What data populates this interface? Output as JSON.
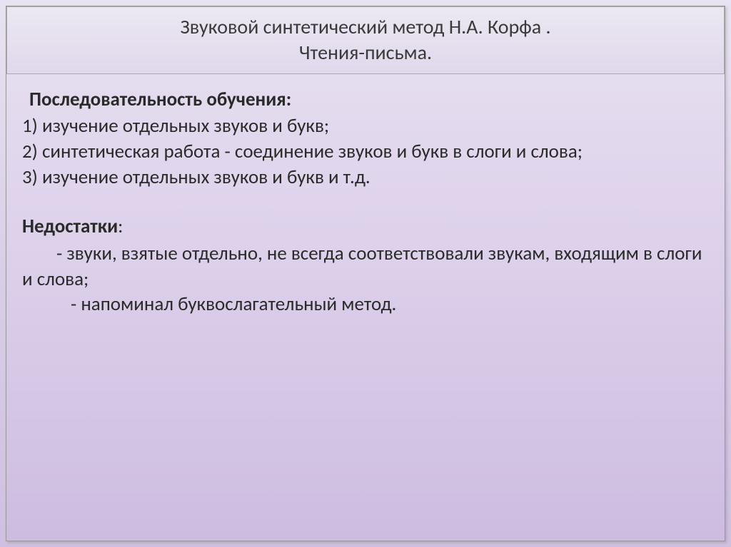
{
  "header": {
    "title_line1": "Звуковой синтетический метод Н.А. Корфа .",
    "title_line2": "Чтения-письма."
  },
  "content": {
    "sequence_heading": "Последовательность обучения:",
    "sequence_items": [
      " 1) изучение отдельных звуков и букв;",
      " 2) синтетическая работа - соединение звуков и букв в слоги и слова;",
      " 3) изучение отдельных звуков и букв и т.д."
    ],
    "drawbacks_heading": "Недостатки",
    "drawbacks_colon": ":",
    "drawbacks_items": [
      "- звуки, взятые отдельно, не всегда соответствовали звукам, входящим в слоги и слова;",
      "- напоминал буквослагательный метод."
    ]
  }
}
